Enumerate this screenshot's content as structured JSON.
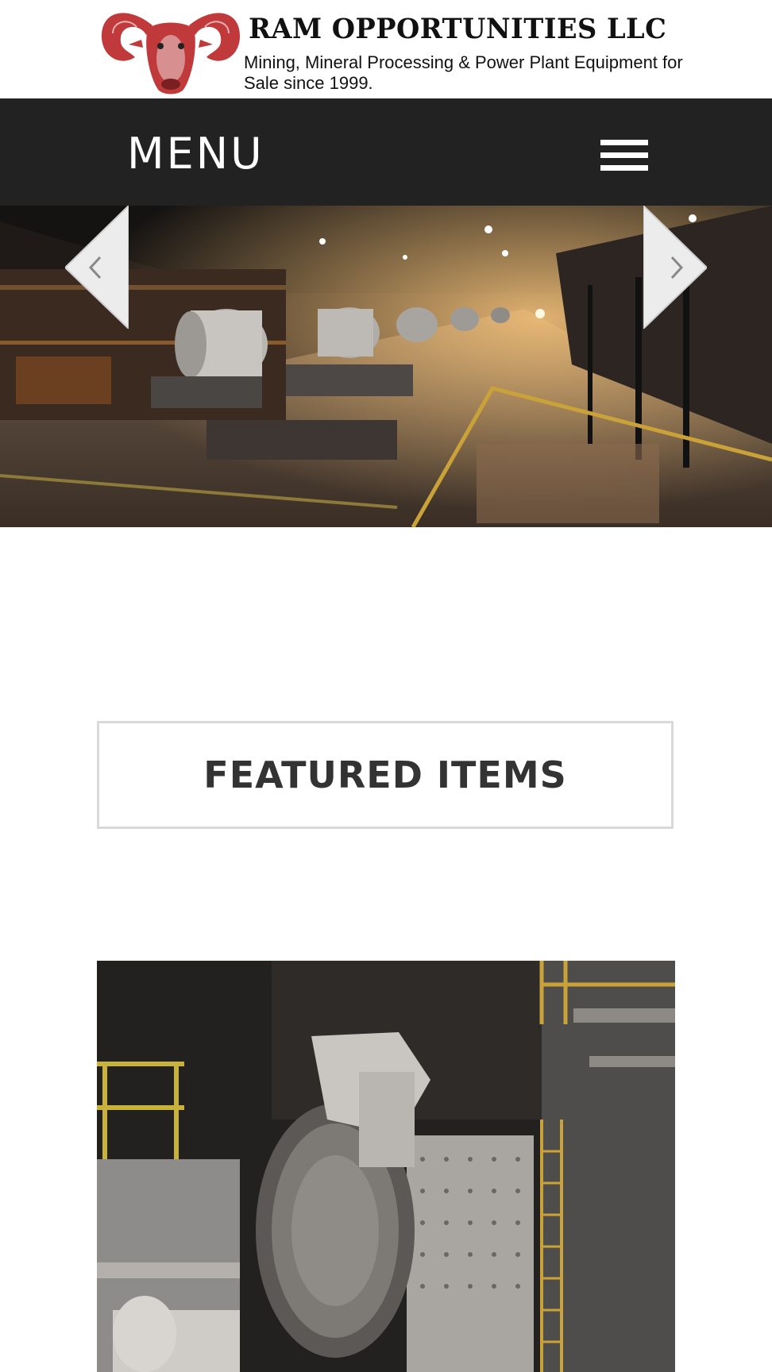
{
  "header": {
    "brand_name": "RAM OPPORTUNITIES LLC",
    "tagline": "Mining, Mineral Processing & Power Plant Equipment for Sale since 1999.",
    "logo_icon": "ram-head-icon",
    "logo_color": "#c0393b"
  },
  "menu": {
    "label": "MENU",
    "toggle_icon": "hamburger-icon"
  },
  "hero_slider": {
    "prev_icon": "chevron-left-icon",
    "next_icon": "chevron-right-icon"
  },
  "featured": {
    "title": "FEATURED ITEMS"
  },
  "colors": {
    "menubar_bg": "#222222",
    "title_text": "#333333",
    "box_border": "#d9d9d9"
  }
}
